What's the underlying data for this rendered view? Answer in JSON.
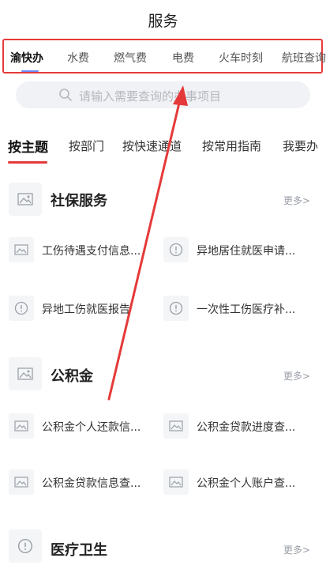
{
  "header": {
    "title": "服务"
  },
  "tabs": [
    {
      "label": "渝快办"
    },
    {
      "label": "水费"
    },
    {
      "label": "燃气费"
    },
    {
      "label": "电费"
    },
    {
      "label": "火车时刻"
    },
    {
      "label": "航班查询"
    }
  ],
  "search": {
    "placeholder": "请输入需要查询的办事项目"
  },
  "subtabs": [
    {
      "label": "按主题"
    },
    {
      "label": "按部门"
    },
    {
      "label": "按快速通道"
    },
    {
      "label": "按常用指南"
    },
    {
      "label": "我要办"
    }
  ],
  "sections": [
    {
      "title": "社保服务",
      "more": "更多>",
      "items": [
        {
          "label": "工伤待遇支付信息..."
        },
        {
          "label": "异地居住就医申请..."
        },
        {
          "label": "异地工伤就医报告"
        },
        {
          "label": "一次性工伤医疗补..."
        }
      ]
    },
    {
      "title": "公积金",
      "more": "更多>",
      "items": [
        {
          "label": "公积金个人还款信..."
        },
        {
          "label": "公积金贷款进度查..."
        },
        {
          "label": "公积金贷款信息查..."
        },
        {
          "label": "公积金个人账户查..."
        }
      ]
    },
    {
      "title": "医疗卫生",
      "more": "更多>"
    }
  ],
  "colors": {
    "highlight": "#e53a3a",
    "tab_indicator": "#6d8cf3",
    "search_bg": "#f0f2f6"
  }
}
